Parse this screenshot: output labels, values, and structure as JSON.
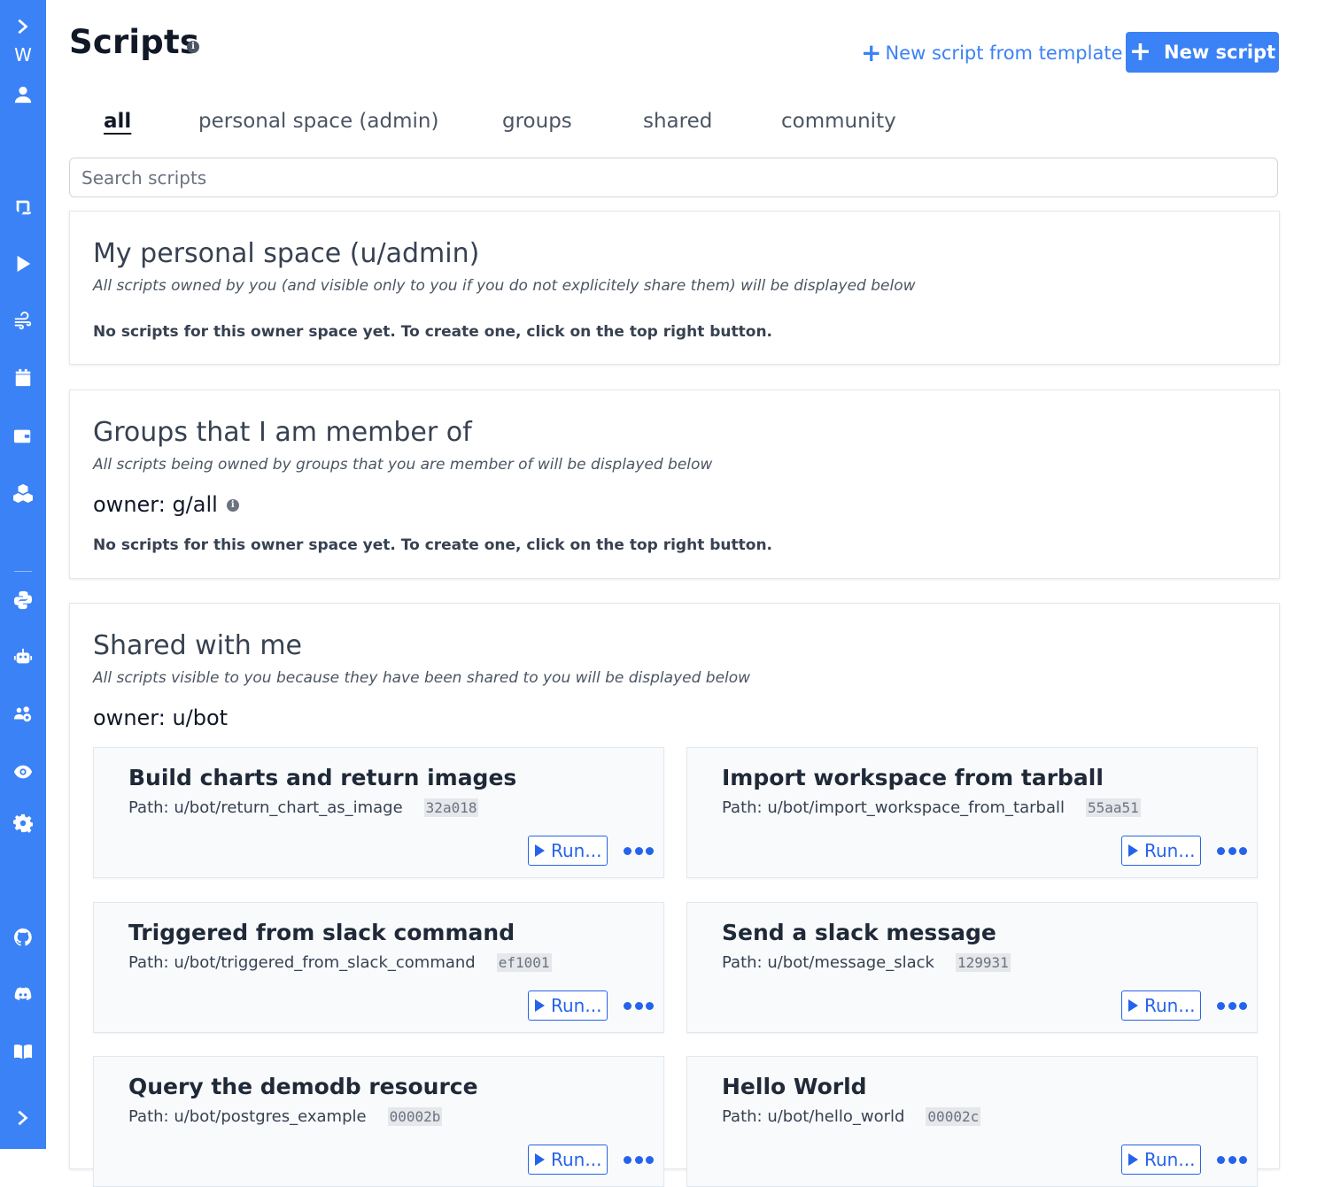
{
  "sidebar": {
    "workspace_initial": "W",
    "items": [
      {
        "icon": "chevron-right-icon"
      },
      {
        "icon": "user-icon"
      },
      {
        "icon": "scroll-icon"
      },
      {
        "icon": "play-icon"
      },
      {
        "icon": "wind-icon"
      },
      {
        "icon": "calendar-icon"
      },
      {
        "icon": "wallet-icon"
      },
      {
        "icon": "cubes-icon"
      },
      {
        "icon": "python-icon"
      },
      {
        "icon": "robot-icon"
      },
      {
        "icon": "users-cog-icon"
      },
      {
        "icon": "eye-icon"
      },
      {
        "icon": "gear-icon"
      },
      {
        "icon": "github-icon"
      },
      {
        "icon": "discord-icon"
      },
      {
        "icon": "book-icon"
      },
      {
        "icon": "chevron-right-icon"
      }
    ],
    "color": "#3b82f6"
  },
  "header": {
    "title": "Scripts",
    "info_glyph": "i",
    "template_button": "New script from template",
    "new_button": "New script"
  },
  "tabs": [
    {
      "label": "all",
      "active": true
    },
    {
      "label": "personal space (admin)",
      "active": false
    },
    {
      "label": "groups",
      "active": false
    },
    {
      "label": "shared",
      "active": false
    },
    {
      "label": "community",
      "active": false
    }
  ],
  "search": {
    "placeholder": "Search scripts",
    "value": ""
  },
  "sections": {
    "personal": {
      "title": "My personal space (u/admin)",
      "description": "All scripts owned by you (and visible only to you if you do not explicitely share them) will be displayed below",
      "empty": "No scripts for this owner space yet. To create one, click on the top right button."
    },
    "groups": {
      "title": "Groups that I am member of",
      "description": "All scripts being owned by groups that you are member of will be displayed below",
      "owner": "owner: g/all",
      "empty": "No scripts for this owner space yet. To create one, click on the top right button."
    },
    "shared": {
      "title": "Shared with me",
      "description": "All scripts visible to you because they have been shared to you will be displayed below",
      "owner": "owner: u/bot",
      "scripts": [
        {
          "title": "Build charts and return images",
          "path": "Path: u/bot/return_chart_as_image",
          "hash": "32a018",
          "run": "Run..."
        },
        {
          "title": "Import workspace from tarball",
          "path": "Path: u/bot/import_workspace_from_tarball",
          "hash": "55aa51",
          "run": "Run..."
        },
        {
          "title": "Triggered from slack command",
          "path": "Path: u/bot/triggered_from_slack_command",
          "hash": "ef1001",
          "run": "Run..."
        },
        {
          "title": "Send a slack message",
          "path": "Path: u/bot/message_slack",
          "hash": "129931",
          "run": "Run..."
        },
        {
          "title": "Query the demodb resource",
          "path": "Path: u/bot/postgres_example",
          "hash": "00002b",
          "run": "Run..."
        },
        {
          "title": "Hello World",
          "path": "Path: u/bot/hello_world",
          "hash": "00002c",
          "run": "Run..."
        }
      ]
    }
  }
}
